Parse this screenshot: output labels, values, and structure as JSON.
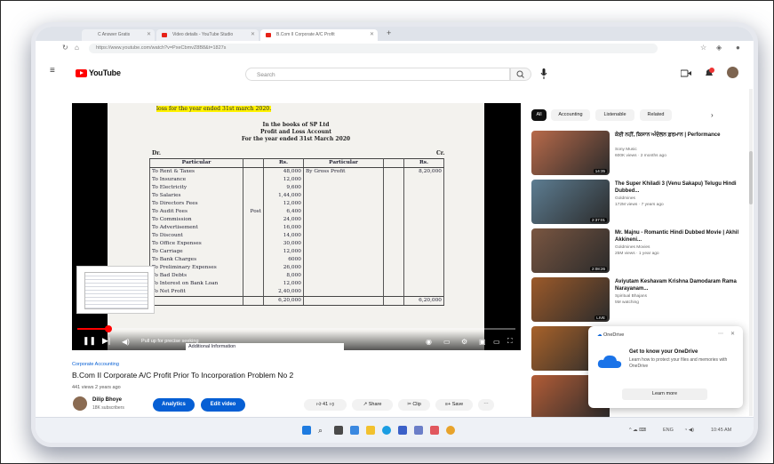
{
  "browser": {
    "tabs": [
      {
        "label": "C Answer Gratis"
      },
      {
        "label": "Video details - YouTube Studio"
      },
      {
        "label": "B.Com II Corporate A/C Profit"
      }
    ],
    "url": "https://www.youtube.com/watch?v=PxeCbmvZ8B8&t=1827s"
  },
  "youtube": {
    "logo": "YouTube",
    "search_placeholder": "Search"
  },
  "video_doc": {
    "heading": "loss for the year ended 31st march 2020.",
    "books": "In the books of SP Ltd",
    "account": "Profit and Loss Account",
    "period": "For the year ended 31st March 2020",
    "dr": "Dr.",
    "cr": "Cr.",
    "columns": {
      "particular": "Particular",
      "rs": "Rs.",
      "particular2": "Particular",
      "rs2": "Rs."
    },
    "rows": [
      {
        "particular": "To Rent & Taxes",
        "rs": "48,000",
        "particular2": "By Gross Profit",
        "rs2": "8,20,000"
      },
      {
        "particular": "To Insurance",
        "rs": "12,000",
        "particular2": "",
        "rs2": ""
      },
      {
        "particular": "To Electricity",
        "rs": "9,600",
        "particular2": "",
        "rs2": ""
      },
      {
        "particular": "To Salaries",
        "rs": "1,44,000",
        "particular2": "",
        "rs2": ""
      },
      {
        "particular": "To Directors Fees",
        "rs": "12,000",
        "particular2": "",
        "rs2": ""
      },
      {
        "particular": "To Audit Fees",
        "note": "Post",
        "rs": "6,400",
        "particular2": "",
        "rs2": ""
      },
      {
        "particular": "To Commission",
        "rs": "24,000",
        "particular2": "",
        "rs2": ""
      },
      {
        "particular": "To Advertisement",
        "rs": "16,000",
        "particular2": "",
        "rs2": ""
      },
      {
        "particular": "To Discount",
        "rs": "14,000",
        "particular2": "",
        "rs2": ""
      },
      {
        "particular": "To Office Expenses",
        "rs": "30,000",
        "particular2": "",
        "rs2": ""
      },
      {
        "particular": "To Carriage",
        "rs": "12,000",
        "particular2": "",
        "rs2": ""
      },
      {
        "particular": "To Bank Charges",
        "rs": "6000",
        "particular2": "",
        "rs2": ""
      },
      {
        "particular": "To Preliminary Expenses",
        "rs": "26,000",
        "particular2": "",
        "rs2": ""
      },
      {
        "particular": "To Bad Debts",
        "rs": "8,000",
        "particular2": "",
        "rs2": ""
      },
      {
        "particular": "To Interest on Bank Loan",
        "rs": "12,000",
        "particular2": "",
        "rs2": ""
      },
      {
        "particular": "To Net Profit",
        "rs": "2,40,000",
        "particular2": "",
        "rs2": ""
      }
    ],
    "total_left": "6,20,000",
    "total_right": "6,20,000",
    "chapter": "Additional Information"
  },
  "player": {
    "time": "Pull up for precise seeking",
    "progress_fraction": 0.07
  },
  "video": {
    "category": "Corporate Accounting",
    "title": "B.Com II Corporate A/C Profit Prior To Incorporation Problem No 2",
    "views": "441 views  2 years ago",
    "channel": "Dilip Bhoye",
    "subscribers": "18K subscribers",
    "analytics": "Analytics",
    "edit_video": "Edit video",
    "likes": "41",
    "share": "Share",
    "clip": "Clip",
    "save": "Save"
  },
  "chips": [
    "All",
    "Accounting",
    "Listenable",
    "Related"
  ],
  "recommendations": [
    {
      "title": "ਕੋਈ ਨਹੀਂ, ਕਿਸਾਨ ਅੰਦੋਲਨ ਫ਼ਰਮਾਨ | Performance",
      "channel": "Sony Music",
      "views": "600K views · 2 months ago",
      "duration": "14:35",
      "color": "#b86a4a"
    },
    {
      "title": "The Super Khiladi 3 (Venu Sakapu) Telugu Hindi Dubbed...",
      "channel": "Goldmines",
      "views": "172M views · 7 years ago",
      "duration": "2:37:01",
      "color": "#5d7d92"
    },
    {
      "title": "Mr. Majnu - Romantic Hindi Dubbed Movie | Akhil Akkineni...",
      "channel": "Goldmines Movies",
      "views": "25M views · 1 year ago",
      "duration": "2:08:26",
      "color": "#7a5641"
    },
    {
      "title": "Aviyutam Keshavam Krishna Damodaram Rama Narayanam...",
      "channel": "Spiritual Bhajans",
      "views": "5M watching",
      "duration": "LIVE",
      "color": "#9c5a2a"
    },
    {
      "title": "",
      "channel": "",
      "views": "",
      "duration": "",
      "color": "#a8622a"
    },
    {
      "title": "",
      "channel": "",
      "views": "",
      "duration": "",
      "color": "#b25c36"
    }
  ],
  "onedrive": {
    "app": "OneDrive",
    "heading": "Get to know your OneDrive",
    "body": "Learn how to protect your files and memories with OneDrive",
    "button": "Learn more"
  },
  "taskbar": {
    "tray_text": "ENG",
    "clock": "10:45 AM"
  }
}
